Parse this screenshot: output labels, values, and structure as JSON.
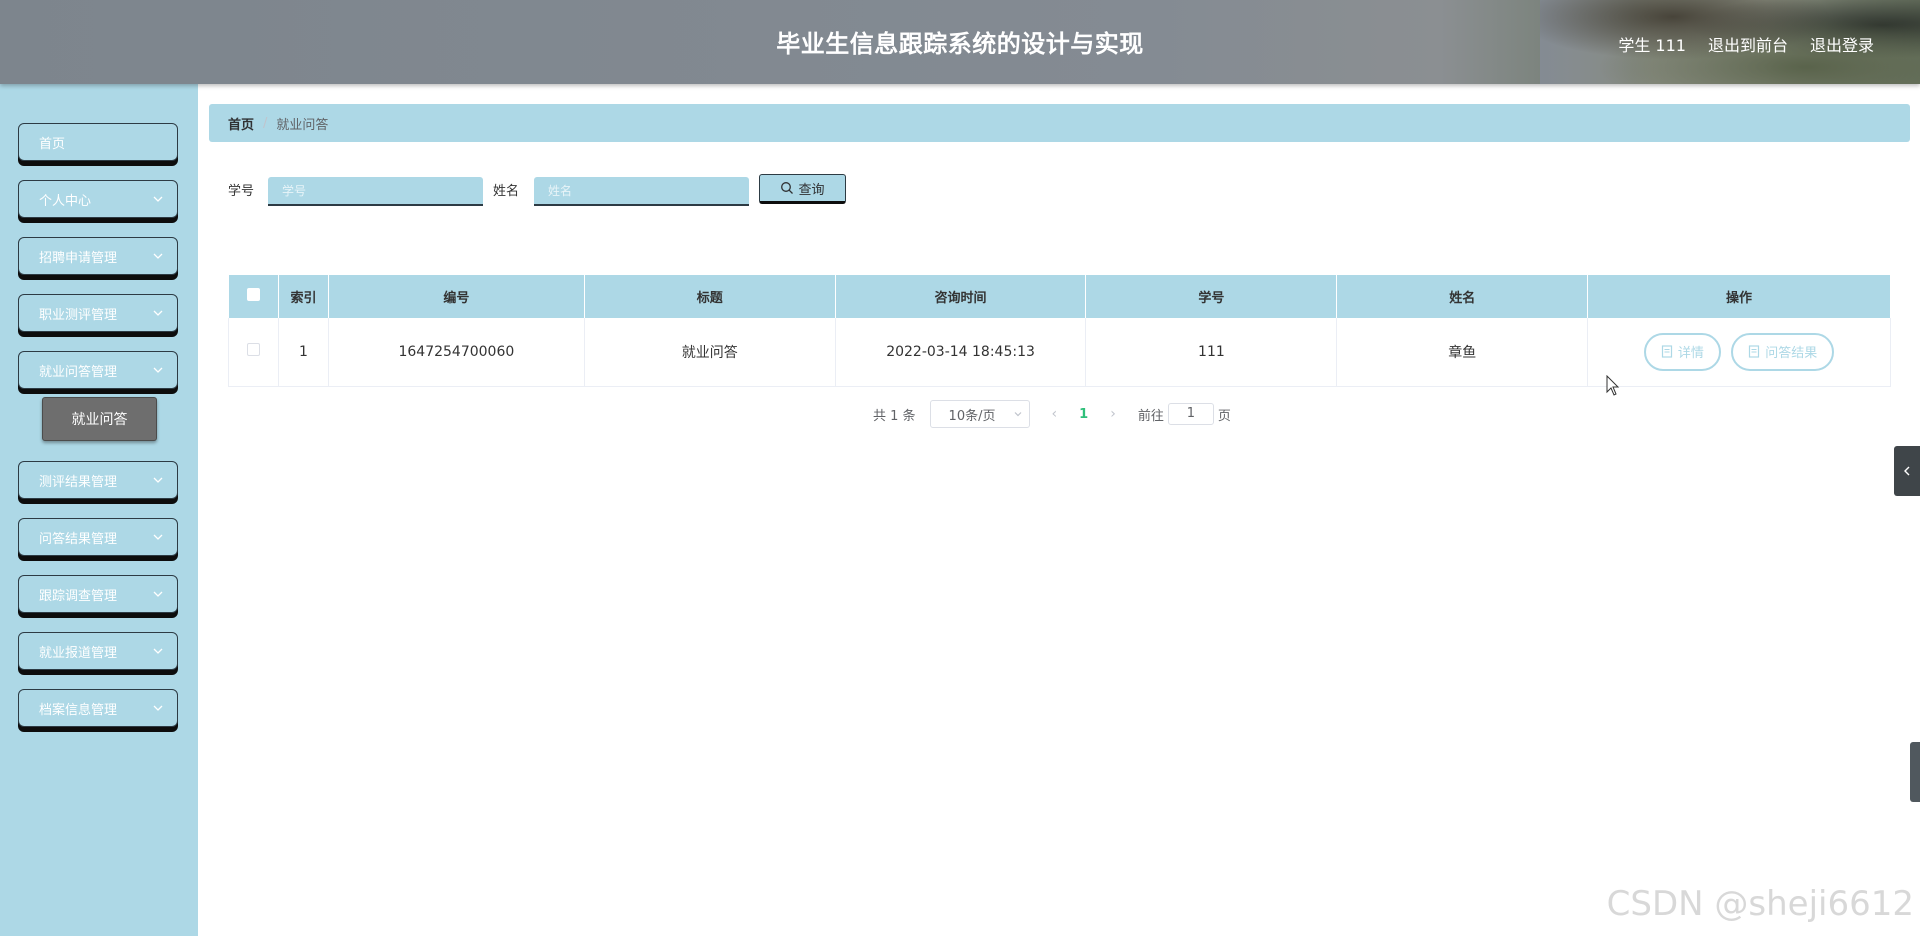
{
  "header": {
    "title": "毕业生信息跟踪系统的设计与实现",
    "user_label": "学生 111",
    "to_front_label": "退出到前台",
    "logout_label": "退出登录"
  },
  "sidebar": {
    "items": [
      {
        "label": "首页",
        "has_submenu": false
      },
      {
        "label": "个人中心",
        "has_submenu": true
      },
      {
        "label": "招聘申请管理",
        "has_submenu": true
      },
      {
        "label": "职业测评管理",
        "has_submenu": true
      },
      {
        "label": "就业问答管理",
        "has_submenu": true,
        "expanded": true
      },
      {
        "label": "测评结果管理",
        "has_submenu": true
      },
      {
        "label": "问答结果管理",
        "has_submenu": true
      },
      {
        "label": "跟踪调查管理",
        "has_submenu": true
      },
      {
        "label": "就业报道管理",
        "has_submenu": true
      },
      {
        "label": "档案信息管理",
        "has_submenu": true
      }
    ],
    "active_submenu": "就业问答"
  },
  "breadcrumb": {
    "home": "首页",
    "separator": "/",
    "current": "就业问答"
  },
  "search": {
    "student_id_label": "学号",
    "student_id_placeholder": "学号",
    "name_label": "姓名",
    "name_placeholder": "姓名",
    "query_label": "查询"
  },
  "table": {
    "columns": [
      "索引",
      "编号",
      "标题",
      "咨询时间",
      "学号",
      "姓名",
      "操作"
    ],
    "rows": [
      {
        "index": "1",
        "number": "1647254700060",
        "title": "就业问答",
        "time": "2022-03-14 18:45:13",
        "student_id": "111",
        "name": "章鱼"
      }
    ],
    "actions": {
      "detail": "详情",
      "result": "问答结果"
    }
  },
  "pagination": {
    "total_text": "共 1 条",
    "page_size": "10条/页",
    "current_page": "1",
    "goto_prefix": "前往",
    "goto_value": "1",
    "goto_suffix": "页"
  },
  "watermark": "CSDN @sheji6612",
  "colors": {
    "accent": "#add8e6",
    "header_bg": "#848b93",
    "active_page": "#2fbf7a"
  }
}
